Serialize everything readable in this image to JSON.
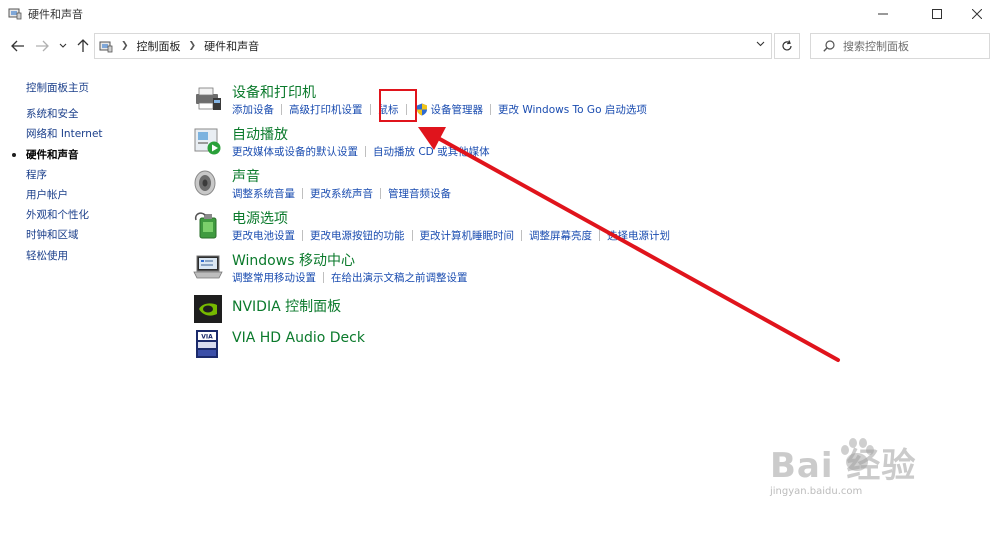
{
  "window": {
    "title": "硬件和声音"
  },
  "address": {
    "crumbs": [
      "控制面板",
      "硬件和声音"
    ]
  },
  "search": {
    "placeholder": "搜索控制面板"
  },
  "sidebar": {
    "items": [
      {
        "label": "控制面板主页"
      },
      {
        "label": "系统和安全"
      },
      {
        "label": "网络和 Internet"
      },
      {
        "label": "硬件和声音"
      },
      {
        "label": "程序"
      },
      {
        "label": "用户帐户"
      },
      {
        "label": "外观和个性化"
      },
      {
        "label": "时钟和区域"
      },
      {
        "label": "轻松使用"
      }
    ]
  },
  "categories": [
    {
      "title": "设备和打印机",
      "icon": "printer-icon",
      "links": [
        "添加设备",
        "高级打印机设置",
        "鼠标",
        "设备管理器",
        "更改 Windows To Go 启动选项"
      ]
    },
    {
      "title": "自动播放",
      "icon": "autoplay-icon",
      "links": [
        "更改媒体或设备的默认设置",
        "自动播放 CD 或其他媒体"
      ]
    },
    {
      "title": "声音",
      "icon": "speaker-icon",
      "links": [
        "调整系统音量",
        "更改系统声音",
        "管理音频设备"
      ]
    },
    {
      "title": "电源选项",
      "icon": "power-icon",
      "links": [
        "更改电池设置",
        "更改电源按钮的功能",
        "更改计算机睡眠时间",
        "调整屏幕亮度",
        "选择电源计划"
      ]
    },
    {
      "title": "Windows 移动中心",
      "icon": "mobility-center-icon",
      "links": [
        "调整常用移动设置",
        "在给出演示文稿之前调整设置"
      ]
    },
    {
      "title": "NVIDIA 控制面板",
      "icon": "nvidia-icon",
      "links": []
    },
    {
      "title": "VIA HD Audio Deck",
      "icon": "via-audio-icon",
      "links": []
    }
  ],
  "watermark": {
    "logo": "Bai 经验",
    "url": "jingyan.baidu.com"
  },
  "colors": {
    "category_title": "#0b7a2c",
    "link": "#1a4cb0",
    "highlight": "#e0141c"
  }
}
